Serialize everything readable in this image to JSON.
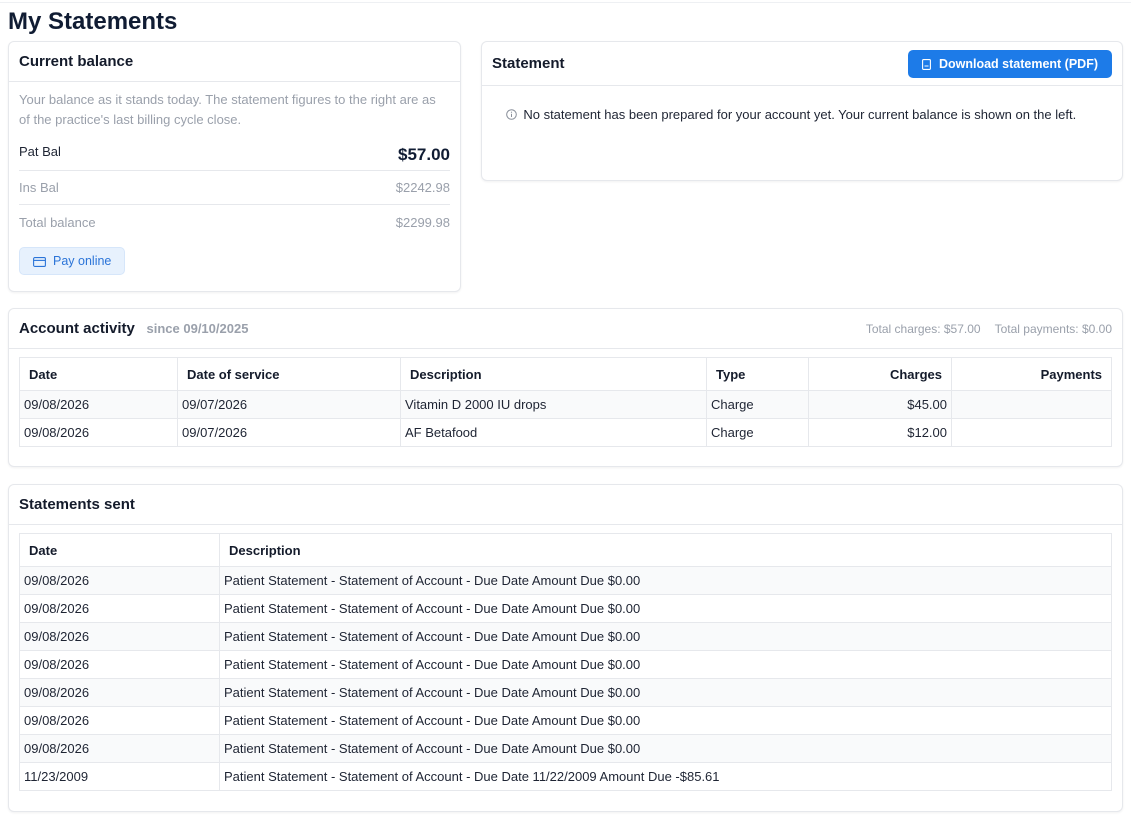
{
  "page": {
    "title": "My Statements"
  },
  "balance": {
    "title": "Current balance",
    "note": "Your balance as it stands today. The statement figures to the right are as of the practice's last billing cycle close.",
    "pat_label": "Pat Bal",
    "pat_value": "$57.00",
    "ins_label": "Ins Bal",
    "ins_value": "$2242.98",
    "total_label": "Total balance",
    "total_value": "$2299.98",
    "pay_label": "Pay online"
  },
  "statement": {
    "title": "Statement",
    "download_label": "Download statement (PDF)",
    "message": "No statement has been prepared for your account yet. Your current balance is shown on the left."
  },
  "activity": {
    "title": "Account activity",
    "since": "since 09/10/2025",
    "total_charges": "Total charges: $57.00",
    "total_payments": "Total payments: $0.00",
    "columns": [
      "Date",
      "Date of service",
      "Description",
      "Type",
      "Charges",
      "Payments"
    ],
    "rows": [
      {
        "date": "09/08/2026",
        "service": "09/07/2026",
        "desc": "Vitamin D 2000 IU drops",
        "type": "Charge",
        "charges": "$45.00",
        "payments": ""
      },
      {
        "date": "09/08/2026",
        "service": "09/07/2026",
        "desc": "AF Betafood",
        "type": "Charge",
        "charges": "$12.00",
        "payments": ""
      }
    ]
  },
  "sent": {
    "title": "Statements sent",
    "columns": [
      "Date",
      "Description"
    ],
    "rows": [
      {
        "date": "09/08/2026",
        "desc": "Patient Statement - Statement of Account - Due Date Amount Due $0.00"
      },
      {
        "date": "09/08/2026",
        "desc": "Patient Statement - Statement of Account - Due Date Amount Due $0.00"
      },
      {
        "date": "09/08/2026",
        "desc": "Patient Statement - Statement of Account - Due Date Amount Due $0.00"
      },
      {
        "date": "09/08/2026",
        "desc": "Patient Statement - Statement of Account - Due Date Amount Due $0.00"
      },
      {
        "date": "09/08/2026",
        "desc": "Patient Statement - Statement of Account - Due Date Amount Due $0.00"
      },
      {
        "date": "09/08/2026",
        "desc": "Patient Statement - Statement of Account - Due Date Amount Due $0.00"
      },
      {
        "date": "09/08/2026",
        "desc": "Patient Statement - Statement of Account - Due Date Amount Due $0.00"
      },
      {
        "date": "11/23/2009",
        "desc": "Patient Statement - Statement of Account - Due Date 11/22/2009 Amount Due -$85.61"
      }
    ]
  }
}
